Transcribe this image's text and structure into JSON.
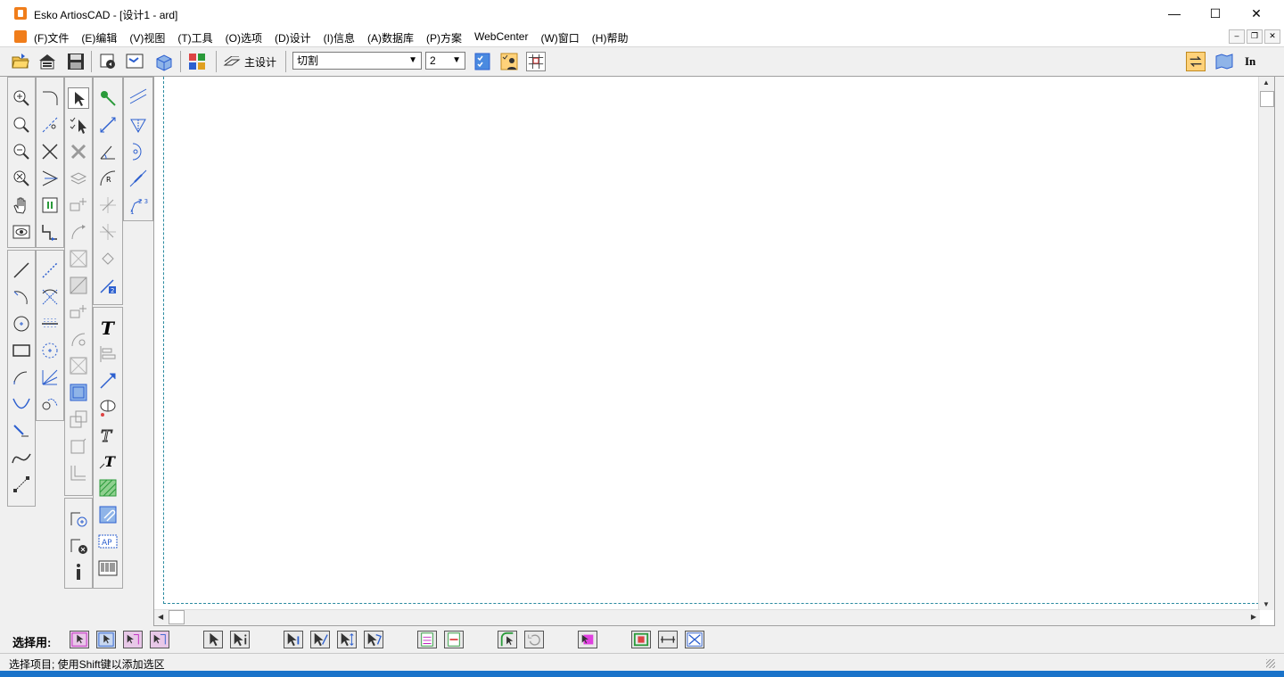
{
  "window": {
    "title": "Esko ArtiosCAD - [设计1 - ard]",
    "minimize": "—",
    "maximize": "☐",
    "close": "✕"
  },
  "menu": {
    "items": [
      "(F)文件",
      "(E)编辑",
      "(V)视图",
      "(T)工具",
      "(O)选项",
      "(D)设计",
      "(I)信息",
      "(A)数据库",
      "(P)方案",
      "WebCenter",
      "(W)窗口",
      "(H)帮助"
    ]
  },
  "toolbar": {
    "main_design_label": "主设计",
    "line_type_value": "切割",
    "pointage_value": "2",
    "units_label": "In"
  },
  "selection_bar": {
    "label": "选择用:"
  },
  "status": {
    "text": "选择项目; 使用Shift键以添加选区"
  },
  "colors": {
    "accent_orange": "#f07d1a",
    "dash_teal": "#2a8aa0",
    "tool_blue": "#2c5fcf",
    "tool_green": "#2a9a3a",
    "highlight_yellow": "#ffd27a"
  }
}
